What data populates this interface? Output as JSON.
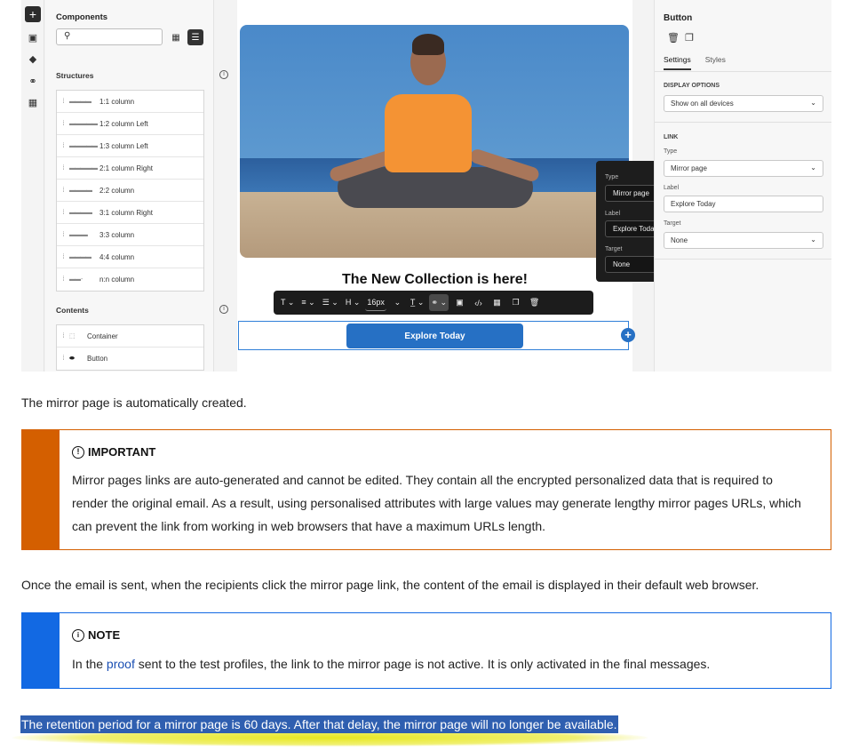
{
  "left_panel": {
    "components_title": "Components",
    "structures_title": "Structures",
    "structures": [
      {
        "label": "1:1 column",
        "glyph": "▬▬▬▬"
      },
      {
        "label": "1:2 column Left",
        "glyph": "▬▬ ▬▬▬"
      },
      {
        "label": "1:3 column Left",
        "glyph": "▬▬ ▬▬▬"
      },
      {
        "label": "2:1 column Right",
        "glyph": "▬▬▬ ▬▬"
      },
      {
        "label": "2:2 column",
        "glyph": "▬▬ ▬▬"
      },
      {
        "label": "3:1 column Right",
        "glyph": "▬▬▬ ▬"
      },
      {
        "label": "3:3 column",
        "glyph": "▬ ▬ ▬"
      },
      {
        "label": "4:4 column",
        "glyph": "▬▬▬▬"
      },
      {
        "label": "n:n column",
        "glyph": "▬▬ -"
      }
    ],
    "contents_title": "Contents",
    "contents": [
      {
        "label": "Container"
      },
      {
        "label": "Button"
      }
    ]
  },
  "canvas": {
    "headline": "The New Collection is here!",
    "cta_label": "Explore Today",
    "toolbar": {
      "font_size": "16px"
    }
  },
  "link_popover": {
    "type_label": "Type",
    "type_value": "Mirror page",
    "label_label": "Label",
    "label_value": "Explore Today",
    "target_label": "Target",
    "target_value": "None"
  },
  "right_panel": {
    "title": "Button",
    "tabs": [
      "Settings",
      "Styles"
    ],
    "display_options_title": "DISPLAY OPTIONS",
    "display_value": "Show on all devices",
    "link_title": "LINK",
    "type_label": "Type",
    "type_value": "Mirror page",
    "label_label": "Label",
    "label_value": "Explore Today",
    "target_label": "Target",
    "target_value": "None"
  },
  "doc": {
    "p1": "The mirror page is automatically created.",
    "important_title": "IMPORTANT",
    "important_body": "Mirror pages links are auto-generated and cannot be edited. They contain all the encrypted personalized data that is required to render the original email. As a result, using personalised attributes with large values may generate lengthy mirror pages URLs, which can prevent the link from working in web browsers that have a maximum URLs length.",
    "p2": "Once the email is sent, when the recipients click the mirror page link, the content of the email is displayed in their default web browser.",
    "note_title": "NOTE",
    "note_before": "In the ",
    "note_link": "proof",
    "note_after": " sent to the test profiles, the link to the mirror page is not active. It is only activated in the final messages.",
    "retention": "The retention period for a mirror page is 60 days. After that delay, the mirror page will no longer be available."
  },
  "colors": {
    "important_bar": "#d45f00",
    "note_bar": "#1269e3",
    "cta_blue": "#2670c4",
    "highlight_blue": "#2f5fb0",
    "marker_yellow": "#e6e614"
  }
}
